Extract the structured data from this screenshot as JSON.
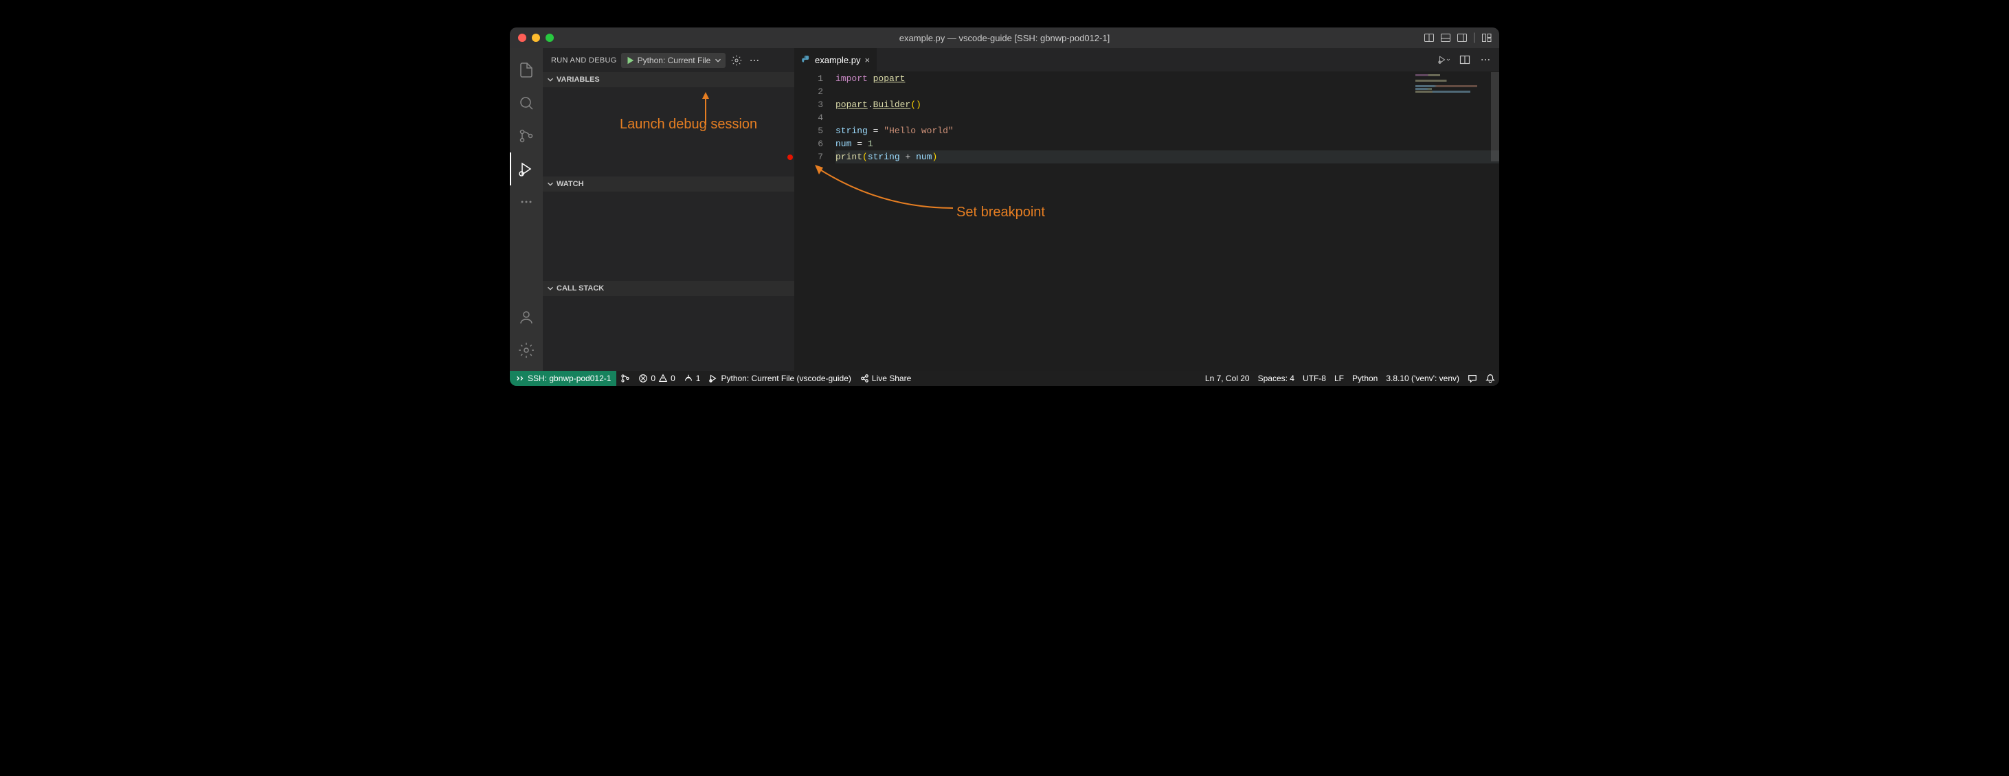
{
  "titlebar": {
    "title": "example.py — vscode-guide [SSH: gbnwp-pod012-1]"
  },
  "sidebar": {
    "title": "RUN AND DEBUG",
    "debug_config": "Python: Current File",
    "sections": {
      "variables": "VARIABLES",
      "watch": "WATCH",
      "call_stack": "CALL STACK"
    }
  },
  "editor": {
    "tab_filename": "example.py",
    "lines": [
      {
        "n": 1,
        "tokens": [
          [
            "kw",
            "import"
          ],
          [
            "sp",
            " "
          ],
          [
            "mod",
            "popart"
          ]
        ]
      },
      {
        "n": 2,
        "tokens": []
      },
      {
        "n": 3,
        "tokens": [
          [
            "mod",
            "popart"
          ],
          [
            "op",
            "."
          ],
          [
            "fn",
            "Builder"
          ],
          [
            "paren-y",
            "()"
          ]
        ]
      },
      {
        "n": 4,
        "tokens": []
      },
      {
        "n": 5,
        "tokens": [
          [
            "var",
            "string"
          ],
          [
            "sp",
            " "
          ],
          [
            "op",
            "="
          ],
          [
            "sp",
            " "
          ],
          [
            "str",
            "\"Hello world\""
          ]
        ]
      },
      {
        "n": 6,
        "tokens": [
          [
            "var",
            "num"
          ],
          [
            "sp",
            " "
          ],
          [
            "op",
            "="
          ],
          [
            "sp",
            " "
          ],
          [
            "num",
            "1"
          ]
        ]
      },
      {
        "n": 7,
        "breakpoint": true,
        "current": true,
        "tokens": [
          [
            "builtin",
            "print"
          ],
          [
            "paren-y",
            "("
          ],
          [
            "var",
            "string"
          ],
          [
            "sp",
            " "
          ],
          [
            "op",
            "+"
          ],
          [
            "sp",
            " "
          ],
          [
            "var",
            "num"
          ],
          [
            "paren-y",
            ")"
          ]
        ]
      }
    ]
  },
  "statusbar": {
    "remote": "SSH: gbnwp-pod012-1",
    "errors": "0",
    "warnings": "0",
    "ports": "1",
    "debug_target": "Python: Current File (vscode-guide)",
    "live_share": "Live Share",
    "cursor": "Ln 7, Col 20",
    "indent": "Spaces: 4",
    "encoding": "UTF-8",
    "eol": "LF",
    "language": "Python",
    "interpreter": "3.8.10 ('venv': venv)"
  },
  "annotations": {
    "launch": "Launch debug session",
    "breakpoint": "Set breakpoint"
  }
}
